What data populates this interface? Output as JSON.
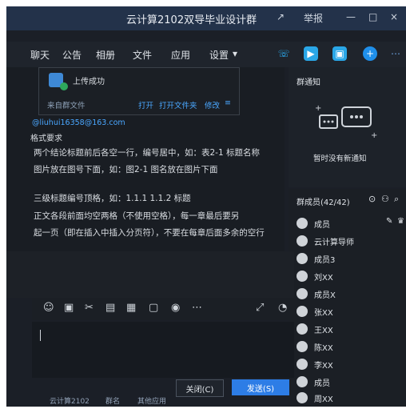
{
  "window": {
    "title": "云计算2102双导毕业设计群",
    "controls": [
      "↗",
      "举报",
      "—",
      "□",
      "×"
    ]
  },
  "nav": {
    "items": [
      "聊天",
      "公告",
      "相册",
      "文件",
      "应用",
      "设置"
    ]
  },
  "chat": {
    "file_card": {
      "status": "上传成功",
      "left_label": "来自群文件",
      "actions": [
        "打开",
        "打开文件夹",
        "修改"
      ]
    },
    "email_line": "@liuhui16358@163.com",
    "lines": [
      "格式要求",
      "两个结论标题前后各空一行，编号居中，如：表2-1 标题名称",
      "图片放在图号下面，如：图2-1 图名放在图片下面",
      "三级标题编号顶格，如：1.1.1 1.1.2 标题",
      "正文各段前面均空两格（不使用空格），每一章最后要另",
      "起一页（即在插入中插入分页符），不要在每章后面多余的空行"
    ]
  },
  "toolbar": {
    "icons": [
      "emoji-icon",
      "gif-icon",
      "scissors-icon",
      "folder-icon",
      "image-icon",
      "screen-icon",
      "bell-icon",
      "more-icon",
      "expand-icon",
      "history-icon"
    ],
    "glyphs": [
      "☺",
      "▣",
      "✂",
      "▤",
      "▦",
      "▢",
      "◉",
      "⋯",
      "⤢",
      "◔"
    ]
  },
  "input": {
    "value": ""
  },
  "buttons": {
    "close": "关闭(C)",
    "send": "发送(S)"
  },
  "bottom_labels": [
    "云计算2102",
    "群名",
    "其他应用"
  ],
  "notice": {
    "title": "群通知",
    "empty_text": "暂时没有新通知"
  },
  "members": {
    "title": "群成员(42/42)",
    "names": [
      "成员",
      "云计算导师",
      "成员3",
      "刘XX",
      "成员X",
      "张XX",
      "王XX",
      "陈XX",
      "李XX",
      "成员",
      "周XX"
    ]
  },
  "colors": {
    "send": "#2d7de6",
    "bg": "#1b1f27",
    "accent_phone": "#2db5ff",
    "accent_video": "#2aa7e8",
    "accent_app": "#1f8fea"
  }
}
